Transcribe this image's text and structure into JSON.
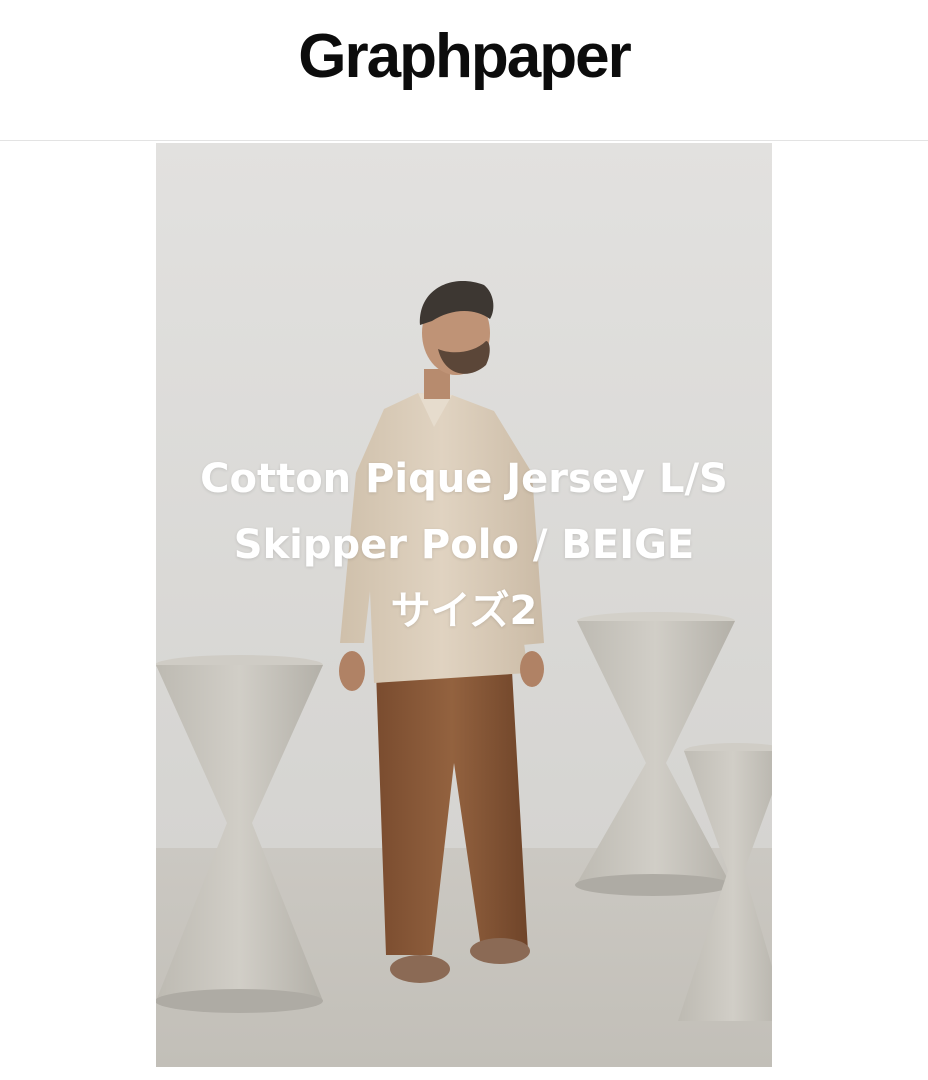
{
  "header": {
    "brand_logo": "Graphpaper"
  },
  "product": {
    "title_line_1": "Cotton Pique Jersey L/S",
    "title_line_2": "Skipper Polo / BEIGE",
    "size_label": "サイズ2"
  },
  "colors": {
    "shirt": "#d9cbb7",
    "trousers": "#8a5a3a",
    "wall": "#dddcda",
    "floor": "#cfccc6",
    "planter": "#c4c1b9"
  }
}
